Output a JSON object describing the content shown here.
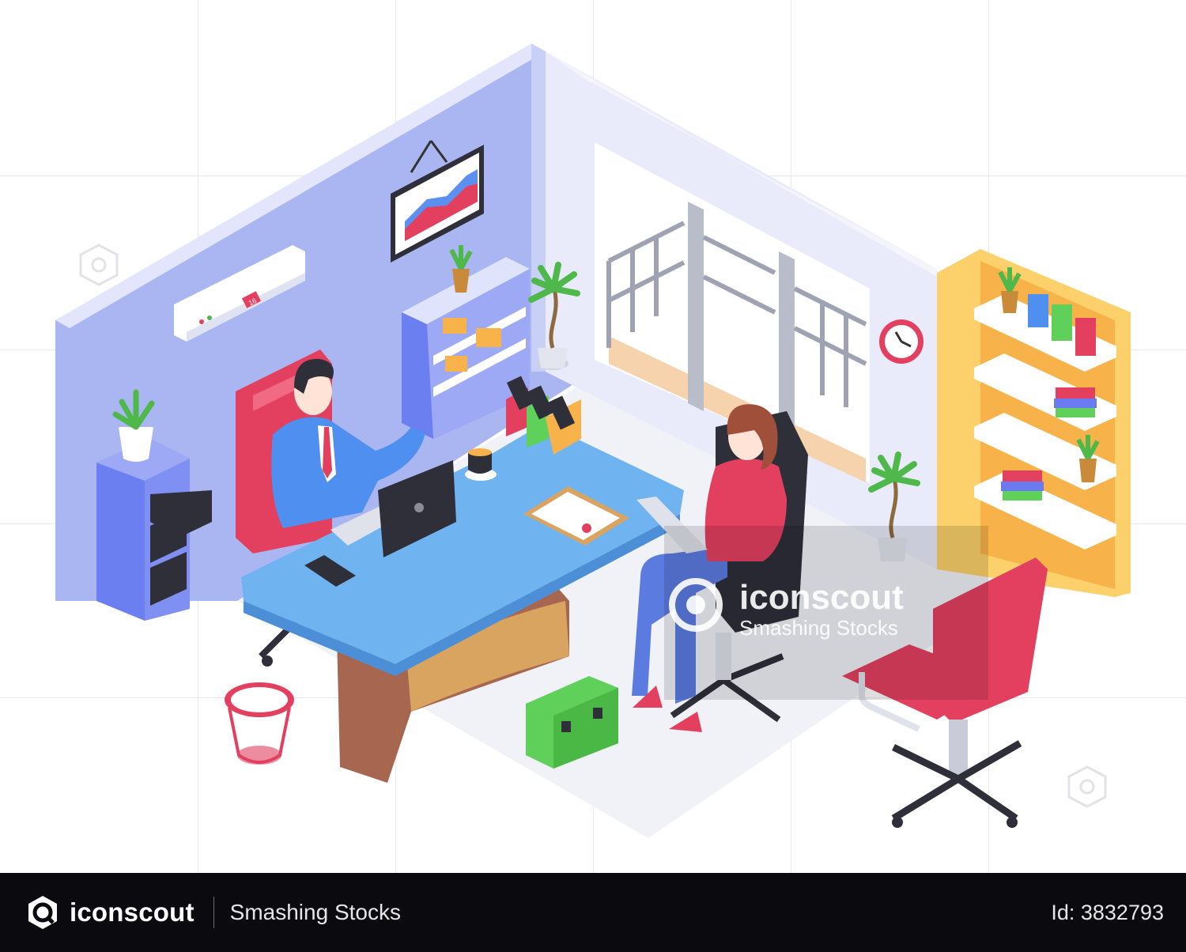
{
  "illustration": {
    "ac_display": "16",
    "watermark_brand": "iconscout",
    "watermark_author": "Smashing Stocks"
  },
  "footer": {
    "brand": "iconscout",
    "author": "Smashing Stocks",
    "id_text": "Id: 3832793"
  },
  "colors": {
    "wall": "#aab6f2",
    "desk": "#6fb4f0",
    "chair_red": "#e3405f",
    "shelf_yellow": "#f8b24a",
    "footer_bg": "#0b0b0f"
  }
}
